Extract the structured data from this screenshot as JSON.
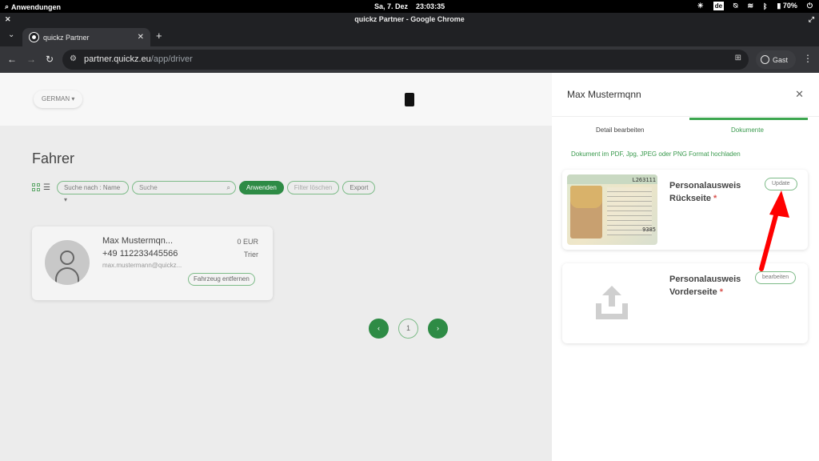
{
  "os": {
    "apps_label": "Anwendungen",
    "date": "Sa, 7. Dez",
    "time": "23:03:35",
    "keyboard_layout": "de",
    "battery": "70%"
  },
  "window": {
    "title": "quickz Partner - Google Chrome"
  },
  "tabs": [
    {
      "title": "quickz Partner"
    }
  ],
  "address": {
    "host": "partner.quickz.eu",
    "path": "/app/driver"
  },
  "profile": {
    "label": "Gast"
  },
  "page": {
    "language_label": "GERMAN",
    "heading": "Fahrer",
    "toolbar": {
      "search_by": "Suche nach : Name",
      "search_placeholder": "Suche",
      "apply": "Anwenden",
      "clear": "Filter löschen",
      "export": "Export"
    },
    "driver": {
      "name": "Max Mustermqn...",
      "phone": "+49 112233445566",
      "email": "max.mustermann@quickz...",
      "balance": "0 EUR",
      "city": "Trier",
      "remove_vehicle": "Fahrzeug entfernen"
    },
    "pagination": {
      "prev": "‹",
      "current": "1",
      "next": "›"
    }
  },
  "drawer": {
    "title": "Max Mustermqnn",
    "tabs": [
      "Detail bearbeiten",
      "Dokumente"
    ],
    "active_tab": "Dokumente",
    "hint": "Dokument im PDF, Jpg, JPEG oder PNG Format hochladen",
    "documents": [
      {
        "title_line1": "Personalausweis",
        "title_line2": "Rückseite",
        "required_mark": "*",
        "button": "Update",
        "id_number": "L263111",
        "id_number_2": "9385"
      },
      {
        "title_line1": "Personalausweis",
        "title_line2": "Vorderseite",
        "required_mark": "*",
        "button": "bearbeiten"
      }
    ]
  },
  "colors": {
    "brand_green": "#2e8b45",
    "accent_green": "#3ca64f",
    "annotation_red": "#ff0000"
  }
}
